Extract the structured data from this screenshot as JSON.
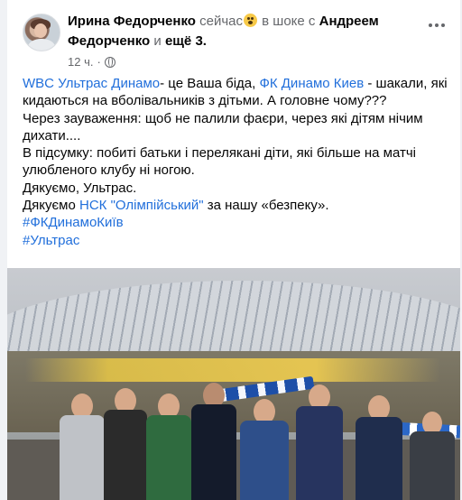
{
  "post": {
    "author": "Ирина Федорченко",
    "now": "сейчас",
    "feeling": "в шоке с",
    "tagged_person": "Андреем Федорченко",
    "and_text": "и",
    "others": "ещё 3.",
    "time": "12 ч.",
    "lines": [
      {
        "segments": [
          {
            "text": "WBC Ультрас Динамо",
            "kind": "link"
          },
          {
            "text": "- це Ваша біда, ",
            "kind": "text"
          },
          {
            "text": "ФК Динамо Киев",
            "kind": "link"
          },
          {
            "text": " - шакали, які кидаються на вболівальників з дітьми. А головне чому???",
            "kind": "text"
          }
        ]
      },
      {
        "segments": [
          {
            "text": "Через зауваження: щоб не палили фаєри, через які дітям нічим дихати....",
            "kind": "text"
          }
        ]
      },
      {
        "segments": [
          {
            "text": "В підсумку: побиті батьки і перелякані діти, які більше на матчі улюбленого клубу ні ногою.",
            "kind": "text"
          }
        ]
      },
      {
        "segments": [
          {
            "text": "Дякуємо, Ультрас.",
            "kind": "text"
          }
        ]
      },
      {
        "segments": [
          {
            "text": "Дякуємо ",
            "kind": "text"
          },
          {
            "text": "НСК \"Олімпійський\"",
            "kind": "link"
          },
          {
            "text": " за нашу «безпеку».",
            "kind": "text"
          }
        ]
      },
      {
        "segments": [
          {
            "text": "#ФКДинамоКиїв",
            "kind": "link"
          }
        ]
      },
      {
        "segments": [
          {
            "text": "#Ультрас",
            "kind": "link"
          }
        ]
      }
    ]
  },
  "icons": {
    "emoji": "shocked-face-emoji",
    "audience": "globe-icon",
    "menu": "more-options-icon"
  },
  "colors": {
    "link": "#216fdb",
    "muted": "#65676b",
    "text": "#050505",
    "background": "#f0f2f5"
  }
}
